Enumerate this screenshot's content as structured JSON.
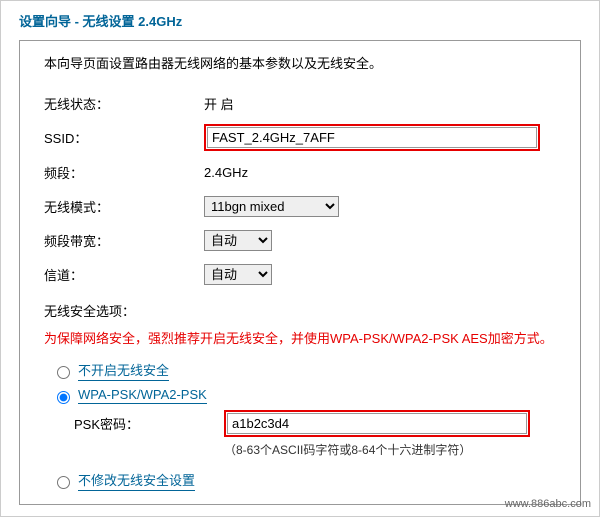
{
  "title": "设置向导 - 无线设置 2.4GHz",
  "intro": "本向导页面设置路由器无线网络的基本参数以及无线安全。",
  "rows": {
    "wireless_status": {
      "label": "无线状态：",
      "value": "开 启"
    },
    "ssid": {
      "label": "SSID：",
      "value": "FAST_2.4GHz_7AFF"
    },
    "band": {
      "label": "频段：",
      "value": "2.4GHz"
    },
    "mode": {
      "label": "无线模式：",
      "value": "11bgn mixed"
    },
    "bandwidth": {
      "label": "频段带宽：",
      "value": "自动"
    },
    "channel": {
      "label": "信道：",
      "value": "自动"
    }
  },
  "security": {
    "section_label": "无线安全选项：",
    "warning": "为保障网络安全，强烈推荐开启无线安全，并使用WPA-PSK/WPA2-PSK AES加密方式。",
    "option_none": "不开启无线安全",
    "option_wpa": "WPA-PSK/WPA2-PSK",
    "psk_label": "PSK密码：",
    "psk_value": "a1b2c3d4",
    "psk_hint": "（8-63个ASCII码字符或8-64个十六进制字符）",
    "option_keep": "不修改无线安全设置"
  },
  "footer_url": "www.886abc.com"
}
